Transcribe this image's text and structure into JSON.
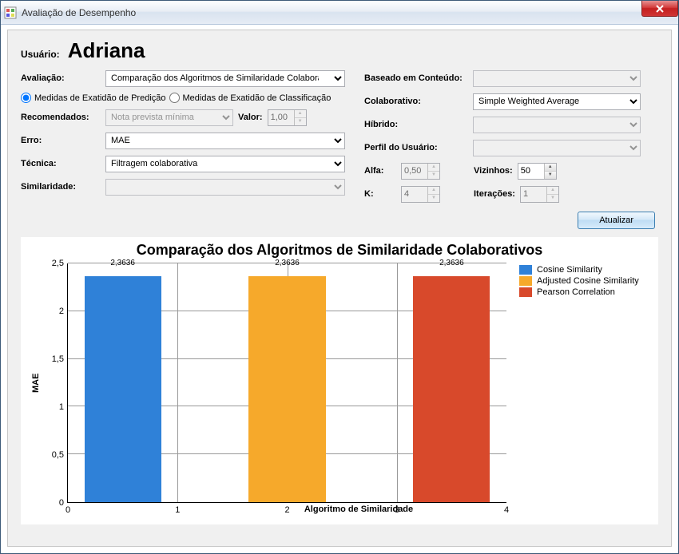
{
  "window": {
    "title": "Avaliação de Desempenho"
  },
  "user": {
    "label": "Usuário:",
    "name": "Adriana"
  },
  "left": {
    "avaliacao_label": "Avaliação:",
    "avaliacao_value": "Comparação dos Algoritmos de Similaridade Colaborativ",
    "radio1": "Medidas de Exatidão de Predição",
    "radio2": "Medidas de Exatidão de Classificação",
    "recomendados_label": "Recomendados:",
    "recomendados_value": "Nota prevista mínima",
    "valor_label": "Valor:",
    "valor_value": "1,00",
    "erro_label": "Erro:",
    "erro_value": "MAE",
    "tecnica_label": "Técnica:",
    "tecnica_value": "Filtragem colaborativa",
    "similaridade_label": "Similaridade:",
    "similaridade_value": ""
  },
  "right": {
    "conteudo_label": "Baseado em Conteúdo:",
    "conteudo_value": "",
    "colaborativo_label": "Colaborativo:",
    "colaborativo_value": "Simple Weighted Average",
    "hibrido_label": "Híbrido:",
    "hibrido_value": "",
    "perfil_label": "Perfil do Usuário:",
    "perfil_value": "",
    "alfa_label": "Alfa:",
    "alfa_value": "0,50",
    "vizinhos_label": "Vizinhos:",
    "vizinhos_value": "50",
    "k_label": "K:",
    "k_value": "4",
    "iteracoes_label": "Iterações:",
    "iteracoes_value": "1"
  },
  "buttons": {
    "atualizar": "Atualizar"
  },
  "chart_data": {
    "type": "bar",
    "title": "Comparação dos Algoritmos de Similaridade Colaborativos",
    "xlabel": "Algoritmo de Similaridade",
    "ylabel": "MAE",
    "ylim": [
      0,
      2.5
    ],
    "yticks": [
      "0",
      "0,5",
      "1",
      "1,5",
      "2",
      "2,5"
    ],
    "xticks": [
      "0",
      "1",
      "2",
      "3",
      "4"
    ],
    "series": [
      {
        "name": "Cosine Similarity",
        "color": "#2f81d8",
        "x_center": 0.5,
        "value": 2.3636,
        "label": "2,3636"
      },
      {
        "name": "Adjusted Cosine Similarity",
        "color": "#f6a92b",
        "x_center": 2.0,
        "value": 2.3636,
        "label": "2,3636"
      },
      {
        "name": "Pearson Correlation",
        "color": "#d8492b",
        "x_center": 3.5,
        "value": 2.3636,
        "label": "2,3636"
      }
    ]
  }
}
